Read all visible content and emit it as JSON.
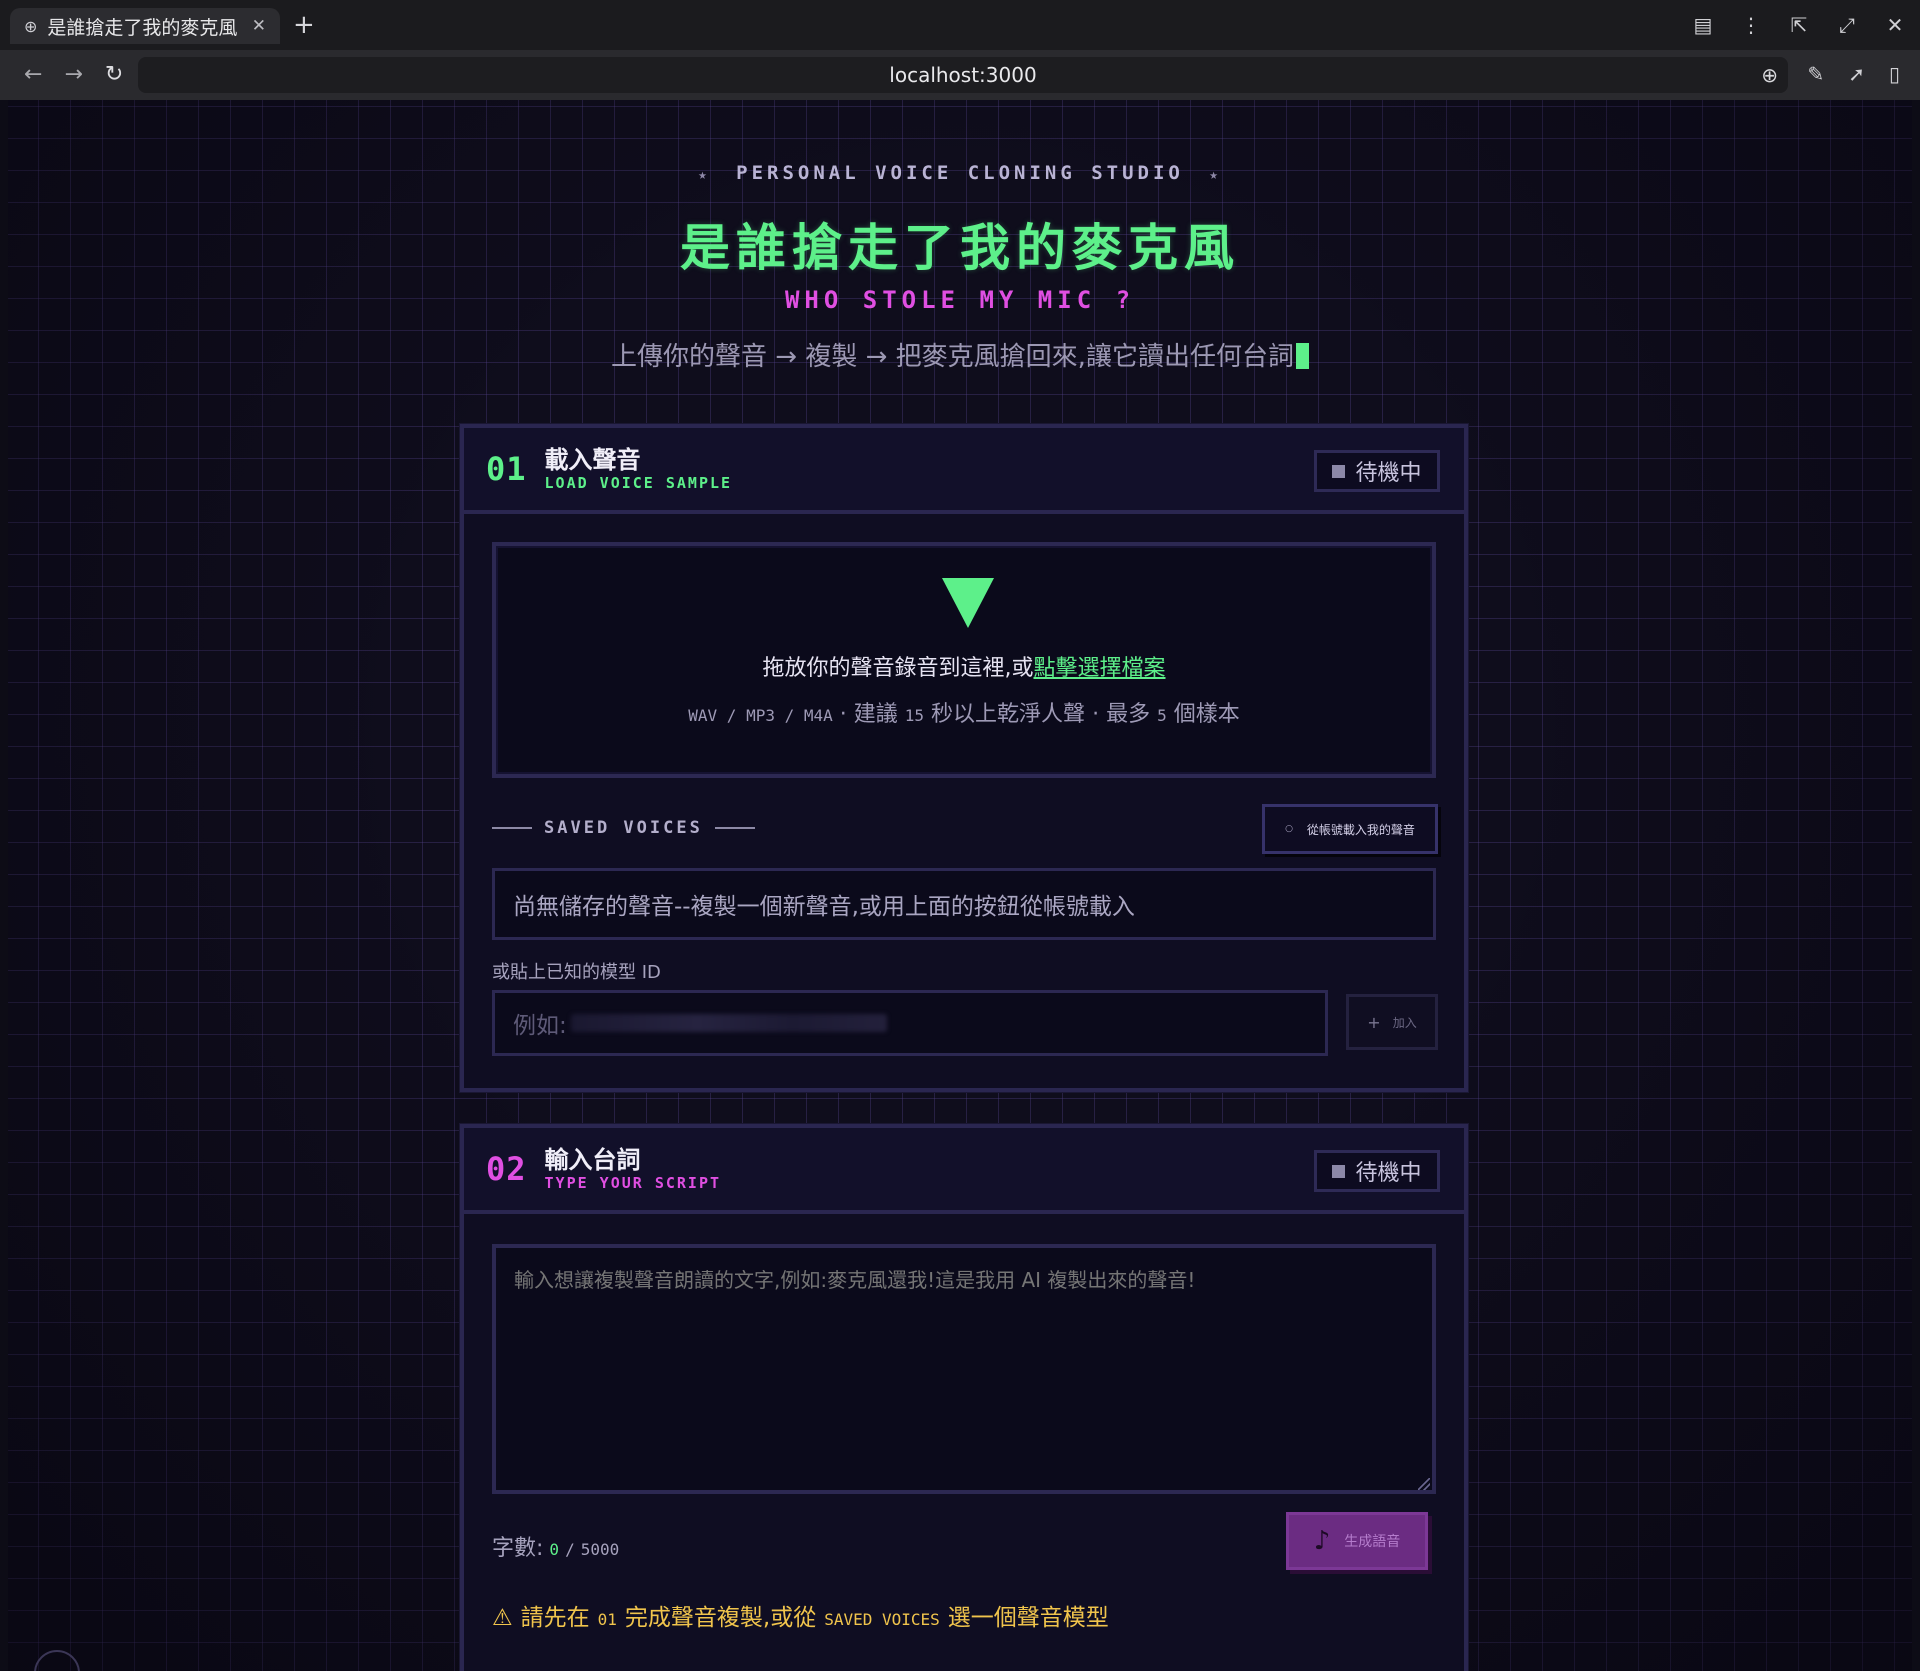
{
  "browser": {
    "tab_title": "是誰搶走了我的麥克風",
    "tab_globe_icon": "globe-icon",
    "url": "localhost:3000"
  },
  "hero": {
    "eyebrow": "PERSONAL VOICE CLONING STUDIO",
    "title": "是誰搶走了我的麥克風",
    "subtitle": "WHO STOLE MY MIC ?",
    "tagline": "上傳你的聲音 → 複製 → 把麥克風搶回來,讓它讀出任何台詞"
  },
  "step1": {
    "number": "01",
    "title_zh": "載入聲音",
    "title_en": "LOAD VOICE SAMPLE",
    "status": "待機中",
    "drop_text": "拖放你的聲音錄音到這裡,或",
    "drop_link": "點擊選擇檔案",
    "hint_formats": "WAV / MP3 / M4A",
    "hint_sep1": "·",
    "hint_suggest": "建議",
    "hint_seconds": "15",
    "hint_suggest2": "秒以上乾淨人聲",
    "hint_sep2": "·",
    "hint_max": "最多",
    "hint_max_n": "5",
    "hint_max2": "個樣本",
    "saved_label": "SAVED VOICES",
    "load_account_label": "從帳號載入我的聲音",
    "saved_empty": "尚無儲存的聲音--複製一個新聲音,或用上面的按鈕從帳號載入",
    "model_label": "或貼上已知的模型 ID",
    "model_placeholder": "例如:",
    "add_label": "加入"
  },
  "step2": {
    "number": "02",
    "title_zh": "輸入台詞",
    "title_en": "TYPE YOUR SCRIPT",
    "status": "待機中",
    "placeholder": "輸入想讓複製聲音朗讀的文字,例如:麥克風還我!這是我用 AI 複製出來的聲音!",
    "count_label": "字數:",
    "count_current": "0",
    "count_sep": "/",
    "count_max": "5000",
    "generate_label": "生成語音",
    "warn_icon": "⚠",
    "warn_pre": "請先在",
    "warn_step": "01",
    "warn_mid": "完成聲音複製,或從",
    "warn_saved": "SAVED VOICES",
    "warn_post": "選一個聲音模型"
  },
  "colors": {
    "accent_green": "#5df08a",
    "accent_pink": "#e04fe2",
    "warning": "#f0c44c",
    "background": "#0f0d1c"
  }
}
